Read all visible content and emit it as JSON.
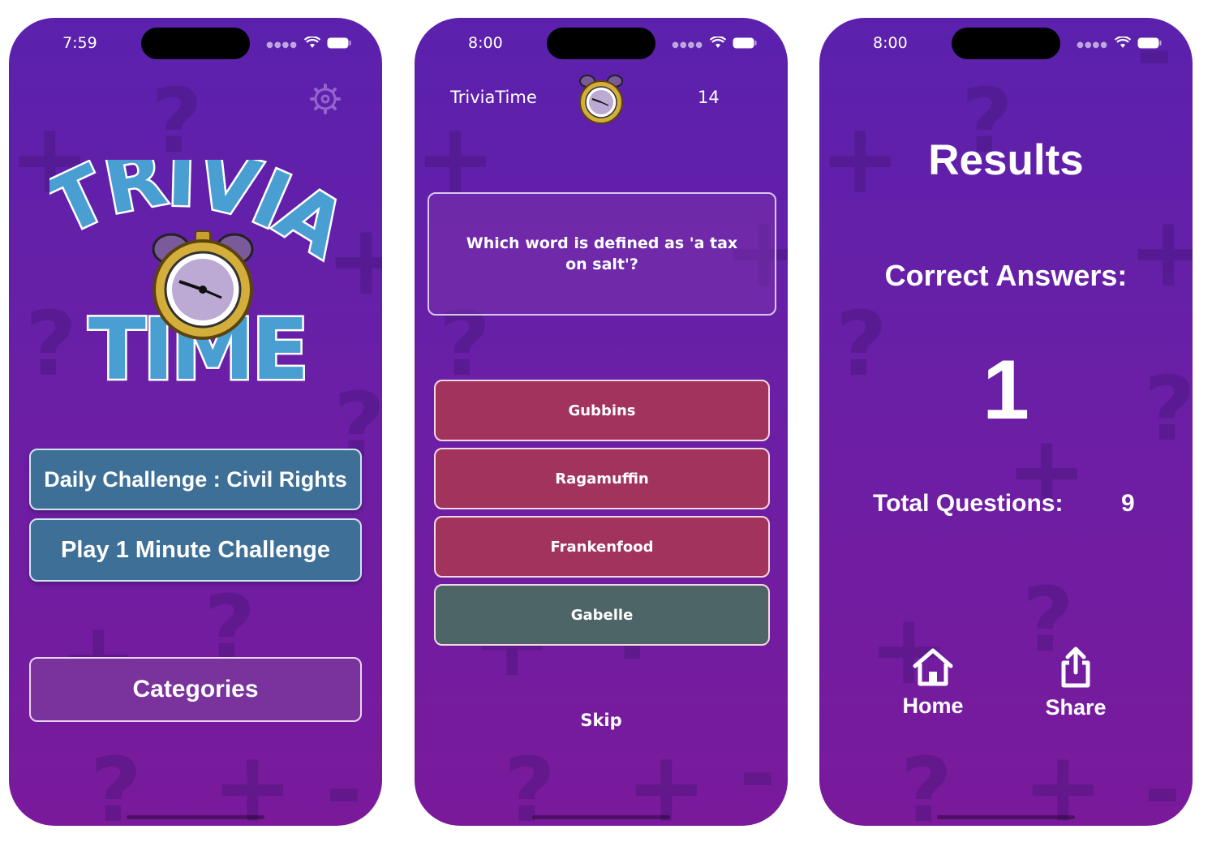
{
  "screens": [
    {
      "status": {
        "time": "7:59"
      },
      "logo": {
        "line1": "TRIVIA",
        "line2": "TIME"
      },
      "buttons": {
        "daily": "Daily Challenge : Civil Rights",
        "minute": "Play 1 Minute Challenge",
        "categories": "Categories"
      },
      "icons": {
        "settings": "gear-icon"
      }
    },
    {
      "status": {
        "time": "8:00"
      },
      "header": {
        "title": "TriviaTime",
        "count": "14"
      },
      "question": "Which word is defined as 'a tax on salt'?",
      "answers": [
        "Gubbins",
        "Ragamuffin",
        "Frankenfood",
        "Gabelle"
      ],
      "skip": "Skip"
    },
    {
      "status": {
        "time": "8:00"
      },
      "title": "Results",
      "correct_label": "Correct Answers:",
      "correct_value": "1",
      "total_label": "Total Questions:",
      "total_value": "9",
      "actions": {
        "home": "Home",
        "share": "Share"
      }
    }
  ],
  "colors": {
    "background_top": "#5b21ad",
    "background_bottom": "#7a1a9b",
    "primary_button": "#3e6f97",
    "answer_wrong": "#a1335d",
    "answer_correct": "#4d6566"
  }
}
